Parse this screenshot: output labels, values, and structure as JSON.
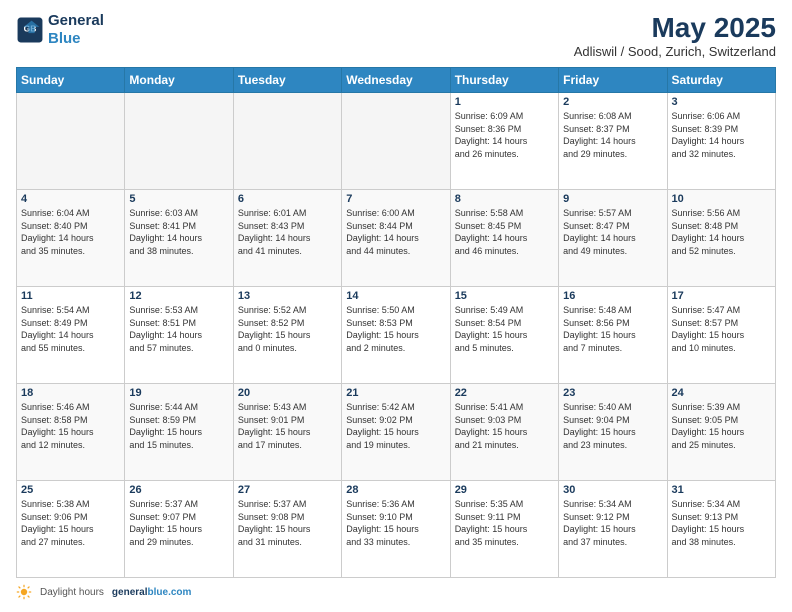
{
  "header": {
    "logo_line1": "General",
    "logo_line2": "Blue",
    "month": "May 2025",
    "location": "Adliswil / Sood, Zurich, Switzerland"
  },
  "days_of_week": [
    "Sunday",
    "Monday",
    "Tuesday",
    "Wednesday",
    "Thursday",
    "Friday",
    "Saturday"
  ],
  "weeks": [
    [
      {
        "num": "",
        "info": ""
      },
      {
        "num": "",
        "info": ""
      },
      {
        "num": "",
        "info": ""
      },
      {
        "num": "",
        "info": ""
      },
      {
        "num": "1",
        "info": "Sunrise: 6:09 AM\nSunset: 8:36 PM\nDaylight: 14 hours\nand 26 minutes."
      },
      {
        "num": "2",
        "info": "Sunrise: 6:08 AM\nSunset: 8:37 PM\nDaylight: 14 hours\nand 29 minutes."
      },
      {
        "num": "3",
        "info": "Sunrise: 6:06 AM\nSunset: 8:39 PM\nDaylight: 14 hours\nand 32 minutes."
      }
    ],
    [
      {
        "num": "4",
        "info": "Sunrise: 6:04 AM\nSunset: 8:40 PM\nDaylight: 14 hours\nand 35 minutes."
      },
      {
        "num": "5",
        "info": "Sunrise: 6:03 AM\nSunset: 8:41 PM\nDaylight: 14 hours\nand 38 minutes."
      },
      {
        "num": "6",
        "info": "Sunrise: 6:01 AM\nSunset: 8:43 PM\nDaylight: 14 hours\nand 41 minutes."
      },
      {
        "num": "7",
        "info": "Sunrise: 6:00 AM\nSunset: 8:44 PM\nDaylight: 14 hours\nand 44 minutes."
      },
      {
        "num": "8",
        "info": "Sunrise: 5:58 AM\nSunset: 8:45 PM\nDaylight: 14 hours\nand 46 minutes."
      },
      {
        "num": "9",
        "info": "Sunrise: 5:57 AM\nSunset: 8:47 PM\nDaylight: 14 hours\nand 49 minutes."
      },
      {
        "num": "10",
        "info": "Sunrise: 5:56 AM\nSunset: 8:48 PM\nDaylight: 14 hours\nand 52 minutes."
      }
    ],
    [
      {
        "num": "11",
        "info": "Sunrise: 5:54 AM\nSunset: 8:49 PM\nDaylight: 14 hours\nand 55 minutes."
      },
      {
        "num": "12",
        "info": "Sunrise: 5:53 AM\nSunset: 8:51 PM\nDaylight: 14 hours\nand 57 minutes."
      },
      {
        "num": "13",
        "info": "Sunrise: 5:52 AM\nSunset: 8:52 PM\nDaylight: 15 hours\nand 0 minutes."
      },
      {
        "num": "14",
        "info": "Sunrise: 5:50 AM\nSunset: 8:53 PM\nDaylight: 15 hours\nand 2 minutes."
      },
      {
        "num": "15",
        "info": "Sunrise: 5:49 AM\nSunset: 8:54 PM\nDaylight: 15 hours\nand 5 minutes."
      },
      {
        "num": "16",
        "info": "Sunrise: 5:48 AM\nSunset: 8:56 PM\nDaylight: 15 hours\nand 7 minutes."
      },
      {
        "num": "17",
        "info": "Sunrise: 5:47 AM\nSunset: 8:57 PM\nDaylight: 15 hours\nand 10 minutes."
      }
    ],
    [
      {
        "num": "18",
        "info": "Sunrise: 5:46 AM\nSunset: 8:58 PM\nDaylight: 15 hours\nand 12 minutes."
      },
      {
        "num": "19",
        "info": "Sunrise: 5:44 AM\nSunset: 8:59 PM\nDaylight: 15 hours\nand 15 minutes."
      },
      {
        "num": "20",
        "info": "Sunrise: 5:43 AM\nSunset: 9:01 PM\nDaylight: 15 hours\nand 17 minutes."
      },
      {
        "num": "21",
        "info": "Sunrise: 5:42 AM\nSunset: 9:02 PM\nDaylight: 15 hours\nand 19 minutes."
      },
      {
        "num": "22",
        "info": "Sunrise: 5:41 AM\nSunset: 9:03 PM\nDaylight: 15 hours\nand 21 minutes."
      },
      {
        "num": "23",
        "info": "Sunrise: 5:40 AM\nSunset: 9:04 PM\nDaylight: 15 hours\nand 23 minutes."
      },
      {
        "num": "24",
        "info": "Sunrise: 5:39 AM\nSunset: 9:05 PM\nDaylight: 15 hours\nand 25 minutes."
      }
    ],
    [
      {
        "num": "25",
        "info": "Sunrise: 5:38 AM\nSunset: 9:06 PM\nDaylight: 15 hours\nand 27 minutes."
      },
      {
        "num": "26",
        "info": "Sunrise: 5:37 AM\nSunset: 9:07 PM\nDaylight: 15 hours\nand 29 minutes."
      },
      {
        "num": "27",
        "info": "Sunrise: 5:37 AM\nSunset: 9:08 PM\nDaylight: 15 hours\nand 31 minutes."
      },
      {
        "num": "28",
        "info": "Sunrise: 5:36 AM\nSunset: 9:10 PM\nDaylight: 15 hours\nand 33 minutes."
      },
      {
        "num": "29",
        "info": "Sunrise: 5:35 AM\nSunset: 9:11 PM\nDaylight: 15 hours\nand 35 minutes."
      },
      {
        "num": "30",
        "info": "Sunrise: 5:34 AM\nSunset: 9:12 PM\nDaylight: 15 hours\nand 37 minutes."
      },
      {
        "num": "31",
        "info": "Sunrise: 5:34 AM\nSunset: 9:13 PM\nDaylight: 15 hours\nand 38 minutes."
      }
    ]
  ],
  "footer": {
    "daylight_label": "Daylight hours",
    "source": "generalblue.com"
  }
}
